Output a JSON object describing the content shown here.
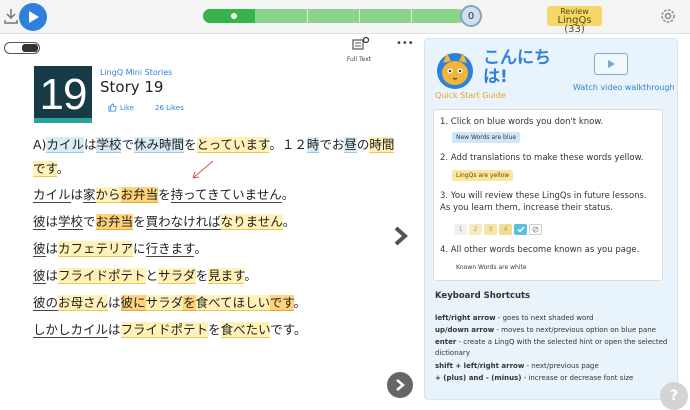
{
  "header": {
    "progress_count": "0",
    "review_line1": "Review",
    "review_line2": "LingQs",
    "review_count": "(33)"
  },
  "toolbar": {
    "view_mode_label": "Full Text",
    "more_label": "•••"
  },
  "lesson": {
    "number": "19",
    "course": "LingQ Mini Stories",
    "title": "Story 19",
    "like_label": "Like",
    "likes_count": "26 Likes"
  },
  "text_lines": [
    [
      [
        "A)",
        "w"
      ],
      [
        "カイル",
        "b"
      ],
      [
        "は",
        "w"
      ],
      [
        "学校",
        "b"
      ],
      [
        "で",
        "w"
      ],
      [
        "休み",
        "b"
      ],
      [
        "時間",
        "b"
      ],
      [
        "を",
        "w"
      ],
      [
        "とっています",
        "y"
      ],
      [
        "。１２",
        "w"
      ],
      [
        "時",
        "b"
      ],
      [
        "で",
        "w"
      ],
      [
        "お",
        "w"
      ],
      [
        "昼",
        "b"
      ],
      [
        "の",
        "w"
      ],
      [
        "時間",
        "y"
      ]
    ],
    [
      [
        "です",
        "y"
      ],
      [
        "。",
        "w"
      ]
    ],
    [
      [
        "カイル",
        "u"
      ],
      [
        "は",
        "w"
      ],
      [
        "家",
        "u"
      ],
      [
        "から",
        "y"
      ],
      [
        "お弁当",
        "o"
      ],
      [
        "を",
        "w"
      ],
      [
        "持ってきていません",
        "u"
      ],
      [
        "。",
        "w"
      ]
    ],
    [
      [
        "彼",
        "u"
      ],
      [
        "は",
        "w"
      ],
      [
        "学校",
        "u"
      ],
      [
        "で",
        "w"
      ],
      [
        "お弁当",
        "o"
      ],
      [
        "を",
        "w"
      ],
      [
        "買わなければ",
        "u"
      ],
      [
        "なりません",
        "y"
      ],
      [
        "。",
        "w"
      ]
    ],
    [
      [
        "彼",
        "u"
      ],
      [
        "は",
        "w"
      ],
      [
        "カフェテリア",
        "y"
      ],
      [
        "に",
        "w"
      ],
      [
        "行きます",
        "u"
      ],
      [
        "。",
        "w"
      ]
    ],
    [
      [
        "彼",
        "u"
      ],
      [
        "は",
        "w"
      ],
      [
        "フライドポテト",
        "y"
      ],
      [
        "と",
        "w"
      ],
      [
        "サラダ",
        "y"
      ],
      [
        "を",
        "w"
      ],
      [
        "見ます",
        "y"
      ],
      [
        "。",
        "w"
      ]
    ],
    [
      [
        "彼の",
        "u"
      ],
      [
        "お母さん",
        "y"
      ],
      [
        "は",
        "w"
      ],
      [
        "彼",
        "o"
      ],
      [
        "に",
        "o"
      ],
      [
        "サラダ",
        "y"
      ],
      [
        "を",
        "o"
      ],
      [
        "食べてほしい",
        "y"
      ],
      [
        "です",
        "o"
      ],
      [
        "。",
        "w"
      ]
    ],
    [
      [
        "しかし",
        "u"
      ],
      [
        "カイル",
        "u"
      ],
      [
        "は",
        "w"
      ],
      [
        "フライドポテト",
        "y"
      ],
      [
        "を",
        "w"
      ],
      [
        "食べたい",
        "y"
      ],
      [
        "です",
        "w"
      ],
      [
        "。",
        "w"
      ]
    ]
  ],
  "panel": {
    "greeting": "こんにちは!",
    "quick_start": "Quick Start Guide",
    "video_label": "Watch video walkthrough",
    "steps": [
      "1. Click on blue words you don't know.",
      "2. Add translations to make these words yellow.",
      "3. You will review these LingQs in future lessons. As you learn them, increase their status.",
      "4. All other words become known as you page."
    ],
    "pill_new": "New Words are blue",
    "pill_lingq": "LingQs are yellow",
    "pill_known": "Known Words are white",
    "status_levels": [
      "1",
      "2",
      "3",
      "4"
    ],
    "keyboard_title": "Keyboard Shortcuts",
    "shortcuts": [
      {
        "key": "left/right arrow",
        "desc": " - goes to next shaded word"
      },
      {
        "key": "up/down arrow",
        "desc": " - moves to next/previous option on blue pane"
      },
      {
        "key": "enter",
        "desc": " - create a LingQ with the selected hint or open the selected dictionary"
      },
      {
        "key": "shift + left/right arrow",
        "desc": " - next/previous page"
      },
      {
        "key": "+ (plus) and - (minus)",
        "desc": " - increase or decrease font size"
      }
    ],
    "help_label": "?"
  },
  "colors": {
    "accent_blue": "#2f7fdc",
    "progress_green": "#38b24a",
    "review_yellow": "#f6d868"
  }
}
